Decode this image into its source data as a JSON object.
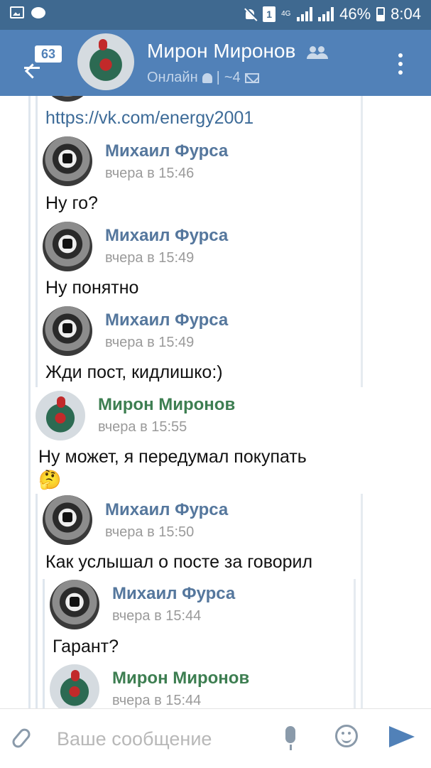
{
  "status_bar": {
    "sim_badge": "1",
    "network": "4G",
    "battery": "46%",
    "time": "8:04"
  },
  "header": {
    "unread_count": "63",
    "contact_name": "Мирон Миронов",
    "presence": "Онлайн",
    "separator": "|",
    "members": "~4"
  },
  "messages": [
    {
      "author": "",
      "time": "",
      "text": "https://vk.com/energy2001"
    },
    {
      "author": "Михаил Фурса",
      "time": "вчера в 15:46",
      "text": "Ну го?"
    },
    {
      "author": "Михаил Фурса",
      "time": "вчера в 15:49",
      "text": "Ну понятно"
    },
    {
      "author": "Михаил Фурса",
      "time": "вчера в 15:49",
      "text": "Жди пост, кидлишко:)"
    },
    {
      "author": "Мирон Миронов",
      "time": "вчера в 15:55",
      "text": "Ну может, я передумал покупать",
      "emoji": "🤔"
    },
    {
      "author": "Михаил Фурса",
      "time": "вчера в 15:50",
      "text": "Как услышал о посте за говорил"
    },
    {
      "author": "Михаил Фурса",
      "time": "вчера в 15:44",
      "text": "Гарант?"
    },
    {
      "author": "Мирон Миронов",
      "time": "вчера в 15:44",
      "text": ""
    }
  ],
  "input": {
    "placeholder": "Ваше сообщение"
  },
  "colors": {
    "status_bar": "#3f6990",
    "header": "#5181b8",
    "author_blue": "#55779d",
    "author_green": "#3d7e51"
  }
}
